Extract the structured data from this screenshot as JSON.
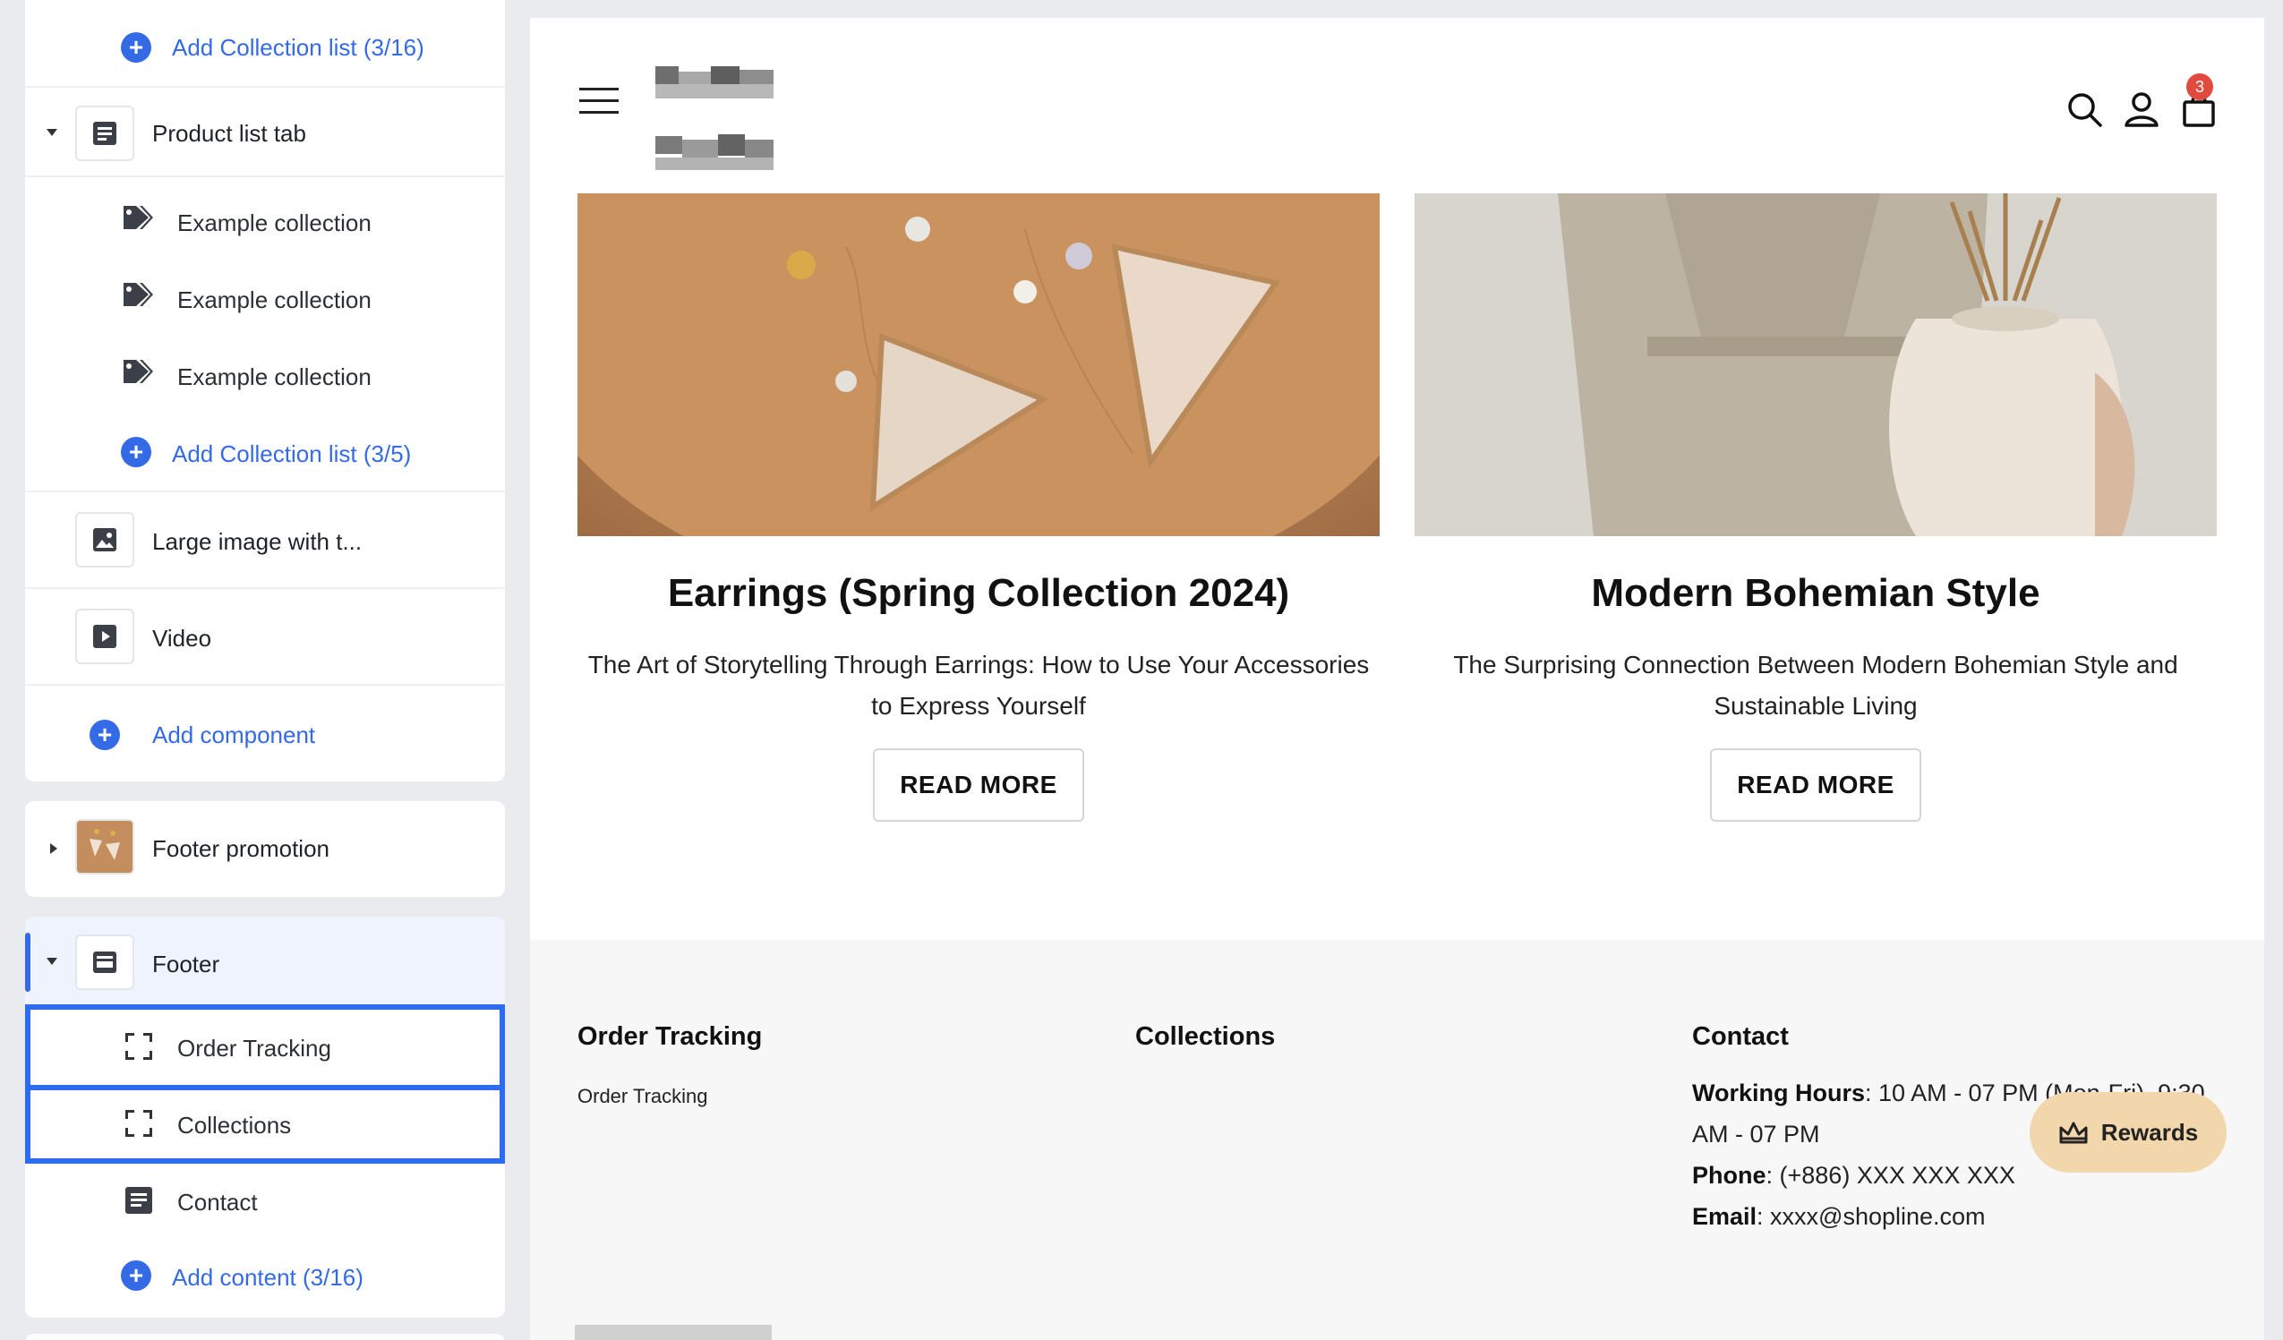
{
  "sidebar": {
    "card1": {
      "add_collection_top": "Add Collection list (3/16)",
      "product_list_tab": "Product list tab",
      "collections": [
        "Example collection",
        "Example collection",
        "Example collection"
      ],
      "add_collection": "Add Collection list (3/5)",
      "large_image": "Large image with t...",
      "video": "Video",
      "add_component": "Add component"
    },
    "footer_promotion": "Footer promotion",
    "footer": {
      "label": "Footer",
      "items": [
        "Order Tracking",
        "Collections",
        "Contact"
      ],
      "add_content": "Add content (3/16)"
    }
  },
  "preview": {
    "cart_count": "3",
    "articles": [
      {
        "title": "Earrings (Spring Collection 2024)",
        "desc": "The Art of Storytelling Through Earrings: How to Use Your Accessories to Express Yourself",
        "button": "READ MORE"
      },
      {
        "title": "Modern Bohemian Style",
        "desc": "The Surprising Connection Between Modern Bohemian Style and Sustainable Living",
        "button": "READ MORE"
      }
    ],
    "footer": {
      "order_tracking_title": "Order Tracking",
      "order_tracking_link": "Order Tracking",
      "collections_title": "Collections",
      "contact_title": "Contact",
      "hours_label": "Working Hours",
      "hours_value": ": 10 AM - 07 PM (Mon-Fri), 9:30 AM - 07 PM",
      "phone_label": "Phone",
      "phone_value": ": (+886) XXX XXX XXX",
      "email_label": "Email",
      "email_value": ": xxxx@shopline.com"
    },
    "rewards": "Rewards"
  },
  "colors": {
    "accent": "#356ae6",
    "highlight": "#2f6bef",
    "badge": "#e04a3f",
    "rewards_bg": "#f2d7ac"
  }
}
